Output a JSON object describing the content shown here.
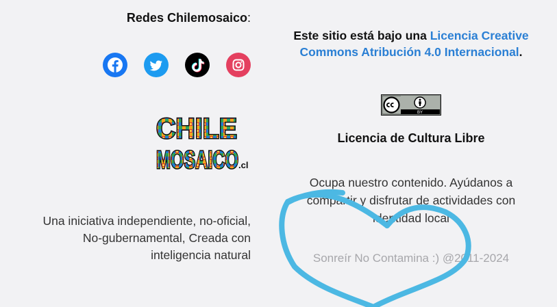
{
  "social": {
    "title": "Redes Chilemosaico",
    "colon": ":",
    "icons": [
      "facebook-icon",
      "twitter-icon",
      "tiktok-icon",
      "instagram-icon"
    ],
    "colors": {
      "facebook": "#1877f2",
      "twitter": "#1d9bf0",
      "tiktok": "#000000",
      "instagram": "#e4405f"
    }
  },
  "logo": {
    "line1": "CHILE",
    "line2": "MOSAICO",
    "suffix": ".cl"
  },
  "tagline": {
    "lines": [
      "Una iniciativa independiente, no-oficial,",
      "No-gubernamental, Creada con",
      "inteligencia natural"
    ]
  },
  "license": {
    "prefix": "Este sitio está bajo una",
    "link": "Licencia Creative Commons Atribución 4.0 Internacional",
    "suffix": ".",
    "badge_by": "BY",
    "badge_icons": [
      "cc-icon",
      "person-icon"
    ],
    "title": "Licencia de Cultura Libre",
    "use_lines": [
      "Ocupa nuestro contenido. Ayúdanos a",
      "compartir y disfrutar de actividades con",
      "identidad local"
    ],
    "copyright": "Sonreír No Contamina :) @2011-2024"
  },
  "annotation": {
    "shape": "heart",
    "color": "#4cb8e3"
  },
  "colors": {
    "background": "#f2f2f4",
    "link": "#2a7fd4",
    "muted": "#a7a7ab"
  }
}
